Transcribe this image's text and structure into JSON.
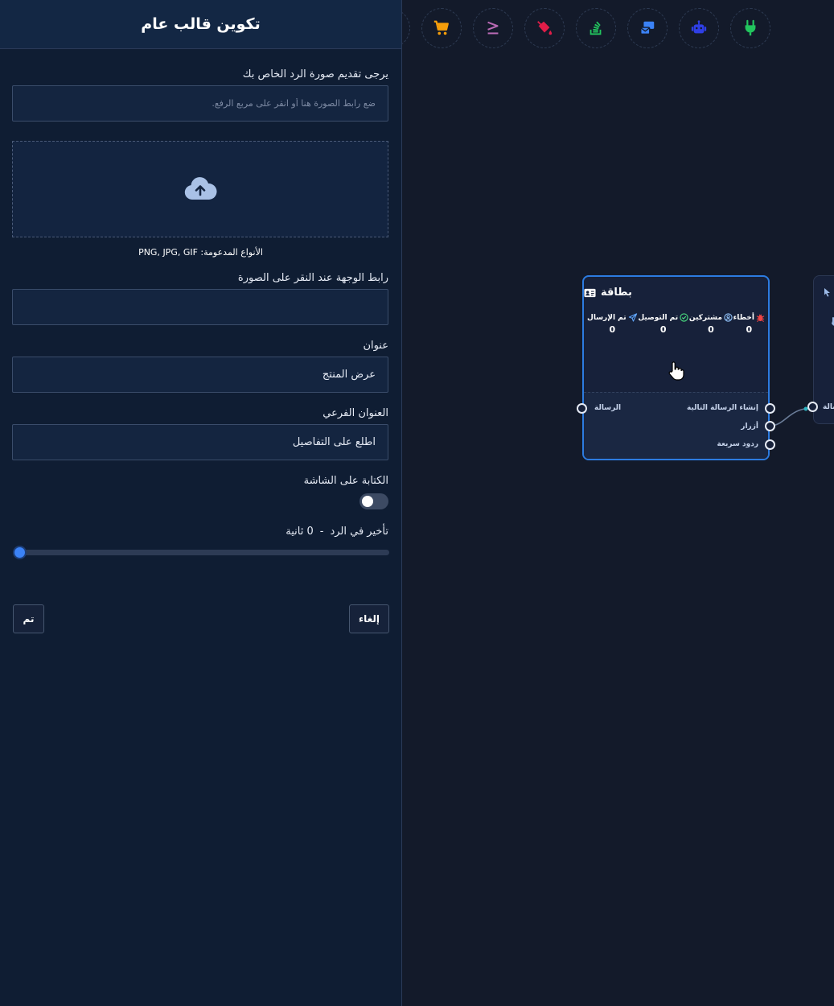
{
  "panel": {
    "title": "تكوين قالب عام",
    "image_prompt_label": "يرجى تقديم صورة الرد الخاص بك",
    "image_url_placeholder": "ضع رابط الصورة هنا أو انقر على مربع الرفع.",
    "supported_types": "الأنواع المدعومة: PNG, JPG, GIF",
    "click_url_label": "رابط الوجهة عند النقر على الصورة",
    "click_url_value": "",
    "title_label": "عنوان",
    "title_value": "عرض المنتج",
    "subtitle_label": "العنوان الفرعي",
    "subtitle_value": "اطّلع على التفاصيل",
    "typing_label": "الكتابة على الشاشة",
    "typing_enabled": false,
    "delay_label": "تأخير في الرد",
    "delay_separator": "-",
    "delay_value": "0 ثانية",
    "delay_fraction": 0,
    "done_button": "تم",
    "cancel_button": "إلغاء"
  },
  "toolbar": {
    "icons": [
      {
        "name": "cart-icon",
        "color": "#f59e0b"
      },
      {
        "name": "greater-equal-icon",
        "color": "#b86ab4"
      },
      {
        "name": "paint-bucket-icon",
        "color": "#e11d48"
      },
      {
        "name": "stack-overflow-icon",
        "color": "#22c55e"
      },
      {
        "name": "mail-bulk-icon",
        "color": "#3b82f6"
      },
      {
        "name": "robot-icon",
        "color": "#2f3fe6"
      },
      {
        "name": "plug-icon",
        "color": "#22c55e"
      }
    ]
  },
  "node": {
    "title": "بطاقة",
    "stats": [
      {
        "label": "أخطاء",
        "value": "0",
        "icon": "bug-icon",
        "color": "#ef4444"
      },
      {
        "label": "مشتركين",
        "value": "0",
        "icon": "user-circle-icon",
        "color": "#93c5fd"
      },
      {
        "label": "تم التوصيل",
        "value": "0",
        "icon": "check-circle-icon",
        "color": "#4ade80"
      },
      {
        "label": "تم الإرسال",
        "value": "0",
        "icon": "paper-plane-icon",
        "color": "#60a5fa"
      }
    ],
    "input_port": "الرسالة",
    "output_ports": [
      "إنشاء الرسالة التالية",
      "أزرار",
      "ردود سريعة"
    ]
  },
  "node2": {
    "port_label": "سالة"
  }
}
